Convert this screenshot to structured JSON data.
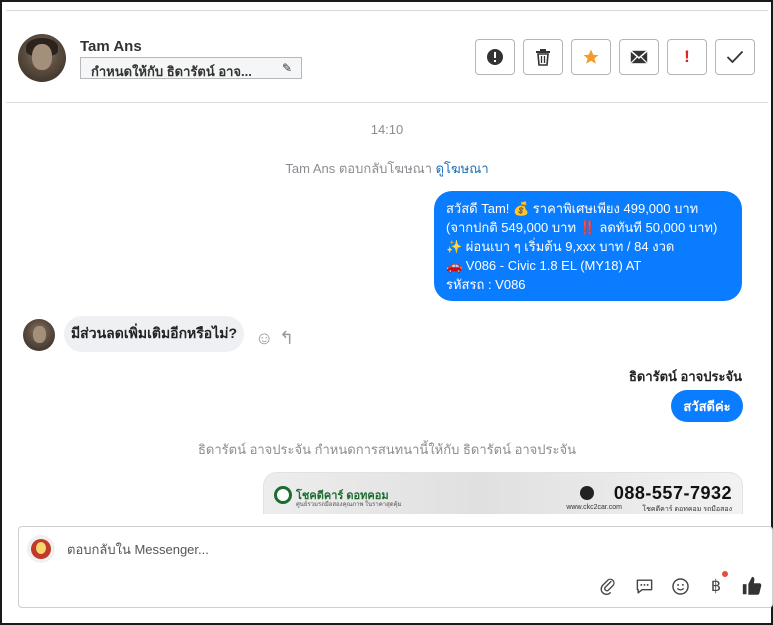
{
  "header": {
    "contact_name": "Tam Ans",
    "assign_label": "กำหนดให้กับ ธิดารัตน์ อาจ...",
    "pencil_glyph": "✎",
    "toolbar": [
      {
        "name": "spam-button",
        "icon": "alert-circle-icon"
      },
      {
        "name": "delete-button",
        "icon": "trash-icon"
      },
      {
        "name": "star-button",
        "icon": "star-icon",
        "color": "#f39c2b"
      },
      {
        "name": "mark-unread-button",
        "icon": "envelope-icon"
      },
      {
        "name": "important-button",
        "icon": "exclamation-icon",
        "glyph": "!",
        "color": "#e0241c"
      },
      {
        "name": "done-button",
        "icon": "check-icon"
      }
    ]
  },
  "chat": {
    "time": "14:10",
    "ad_reply": {
      "text": "Tam Ans ตอบกลับโฆษณา ",
      "link": "ดูโฆษณา"
    },
    "promo_lines": [
      "สวัสดี Tam! 💰 ราคาพิเศษเพียง 499,000 บาท",
      "(จากปกติ 549,000 บาท ‼️ ลดทันที 50,000 บาท)",
      "✨ ผ่อนเบา ๆ เริ่มต้น 9,xxx บาท / 84 งวด",
      "🚗 V086 - Civic 1.8 EL (MY18) AT",
      "รหัสรถ : V086"
    ],
    "customer_message": "มีส่วนลดเพิ่มเติมอีกหรือไม่?",
    "react_glyph": "☺",
    "reply_glyph": "↰",
    "agent_name": "ธิดารัตน์ อาจประจัน",
    "agent_message": "สวัสดีค่ะ",
    "assign_notice": "ธิดารัตน์ อาจประจัน กำหนดการสนทนานี้ให้กับ ธิดารัตน์ อาจประจัน",
    "card": {
      "brand": "โชคดีคาร์ ดอทคอม",
      "brand_sub": "ศูนย์รวมรถมือสองคุณภาพ ในราคาสุดคุ้ม",
      "phone": "088-557-7932",
      "website": "www.ckc2car.com",
      "facebook": "โชคดีคาร์ ดอทคอม รถมือสอง"
    }
  },
  "composer": {
    "placeholder": "ตอบกลับใน Messenger...",
    "icons": [
      "paperclip-icon",
      "saved-replies-icon",
      "emoji-icon",
      "baht-icon",
      "like-icon"
    ],
    "baht_glyph": "฿"
  },
  "colors": {
    "accent": "#0a7cff",
    "star": "#f39c2b",
    "important": "#e0241c"
  }
}
